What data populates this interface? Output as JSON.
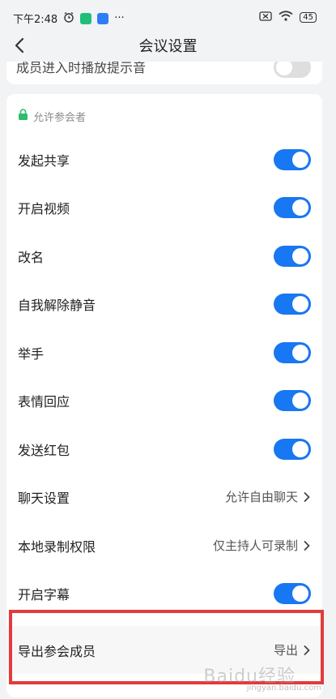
{
  "status_bar": {
    "time": "下午2:48",
    "more": "···",
    "battery": "45"
  },
  "header": {
    "title": "会议设置"
  },
  "partial_row": {
    "label": "成员进入时播放提示音"
  },
  "section": {
    "title": "允许参会者",
    "toggle_rows": [
      {
        "label": "发起共享",
        "on": true
      },
      {
        "label": "开启视频",
        "on": true
      },
      {
        "label": "改名",
        "on": true
      },
      {
        "label": "自我解除静音",
        "on": true
      },
      {
        "label": "举手",
        "on": true
      },
      {
        "label": "表情回应",
        "on": true
      },
      {
        "label": "发送红包",
        "on": true
      }
    ],
    "chat_setting": {
      "label": "聊天设置",
      "value": "允许自由聊天"
    },
    "record_permission": {
      "label": "本地录制权限",
      "value": "仅主持人可录制"
    },
    "captions": {
      "label": "开启字幕",
      "on": true
    },
    "export_members": {
      "label": "导出参会成员",
      "value": "导出"
    }
  },
  "watermark": {
    "text": "Baidu经验",
    "sub": "jingyan.baidu.com"
  },
  "colors": {
    "accent": "#1877f2",
    "highlight": "#e33b3b"
  }
}
